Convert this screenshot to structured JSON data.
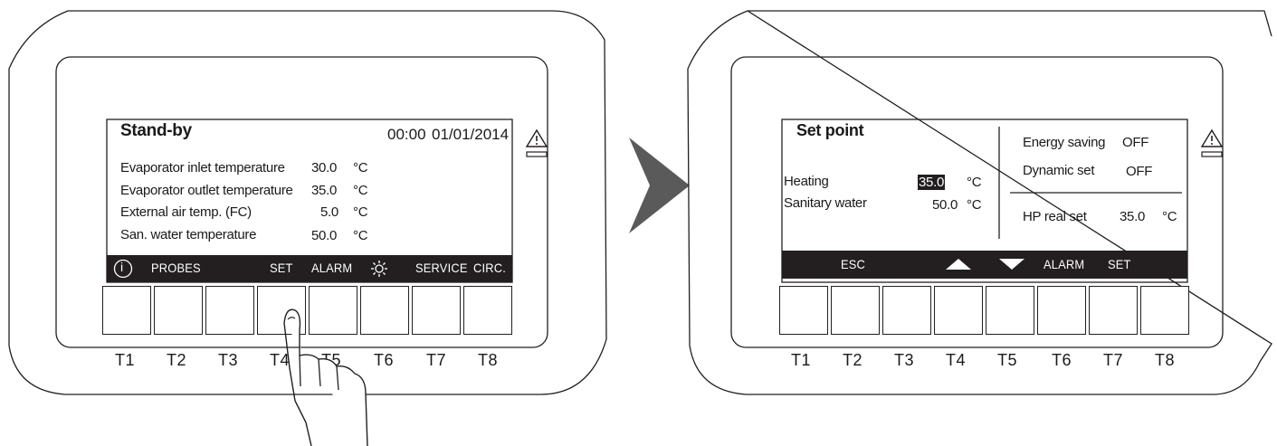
{
  "left_device": {
    "title": "Stand-by",
    "time": "00:00",
    "date": "01/01/2014",
    "rows": [
      {
        "label": "Evaporator inlet temperature",
        "value": "30.0",
        "unit": "°C"
      },
      {
        "label": "Evaporator outlet temperature",
        "value": "35.0",
        "unit": "°C"
      },
      {
        "label": "External air temp. (FC)",
        "value": "5.0",
        "unit": "°C"
      },
      {
        "label": "San. water temperature",
        "value": "50.0",
        "unit": "°C"
      }
    ],
    "menu": {
      "info_symbol": "i",
      "probes": "PROBES",
      "set": "SET",
      "alarm": "ALARM",
      "service": "SERVICE",
      "circ": "CIRC."
    },
    "keys": [
      "T1",
      "T2",
      "T3",
      "T4",
      "T5",
      "T6",
      "T7",
      "T8"
    ],
    "pressed_key": "T4"
  },
  "right_device": {
    "title": "Set point",
    "rows": [
      {
        "label": "Heating",
        "value": "35.0",
        "unit": "°C"
      },
      {
        "label": "Sanitary water",
        "value": "50.0",
        "unit": "°C"
      }
    ],
    "side": {
      "energy_saving_label": "Energy saving",
      "energy_saving_value": "OFF",
      "dynamic_set_label": "Dynamic set",
      "dynamic_set_value": "OFF",
      "hp_real_set_label": "HP real set",
      "hp_real_set_value": "35.0",
      "hp_real_set_unit": "°C"
    },
    "menu": {
      "esc": "ESC",
      "alarm": "ALARM",
      "set": "SET"
    },
    "keys": [
      "T1",
      "T2",
      "T3",
      "T4",
      "T5",
      "T6",
      "T7",
      "T8"
    ]
  },
  "icons": {
    "warning": "warning-triangle-icon",
    "sun": "sun-icon",
    "up": "arrow-up-icon",
    "down": "arrow-down-icon",
    "transition": "arrow-right-icon",
    "hand": "hand-pointer-icon"
  },
  "colors": {
    "ink": "#231f20",
    "arrow": "#5a5a5a"
  }
}
